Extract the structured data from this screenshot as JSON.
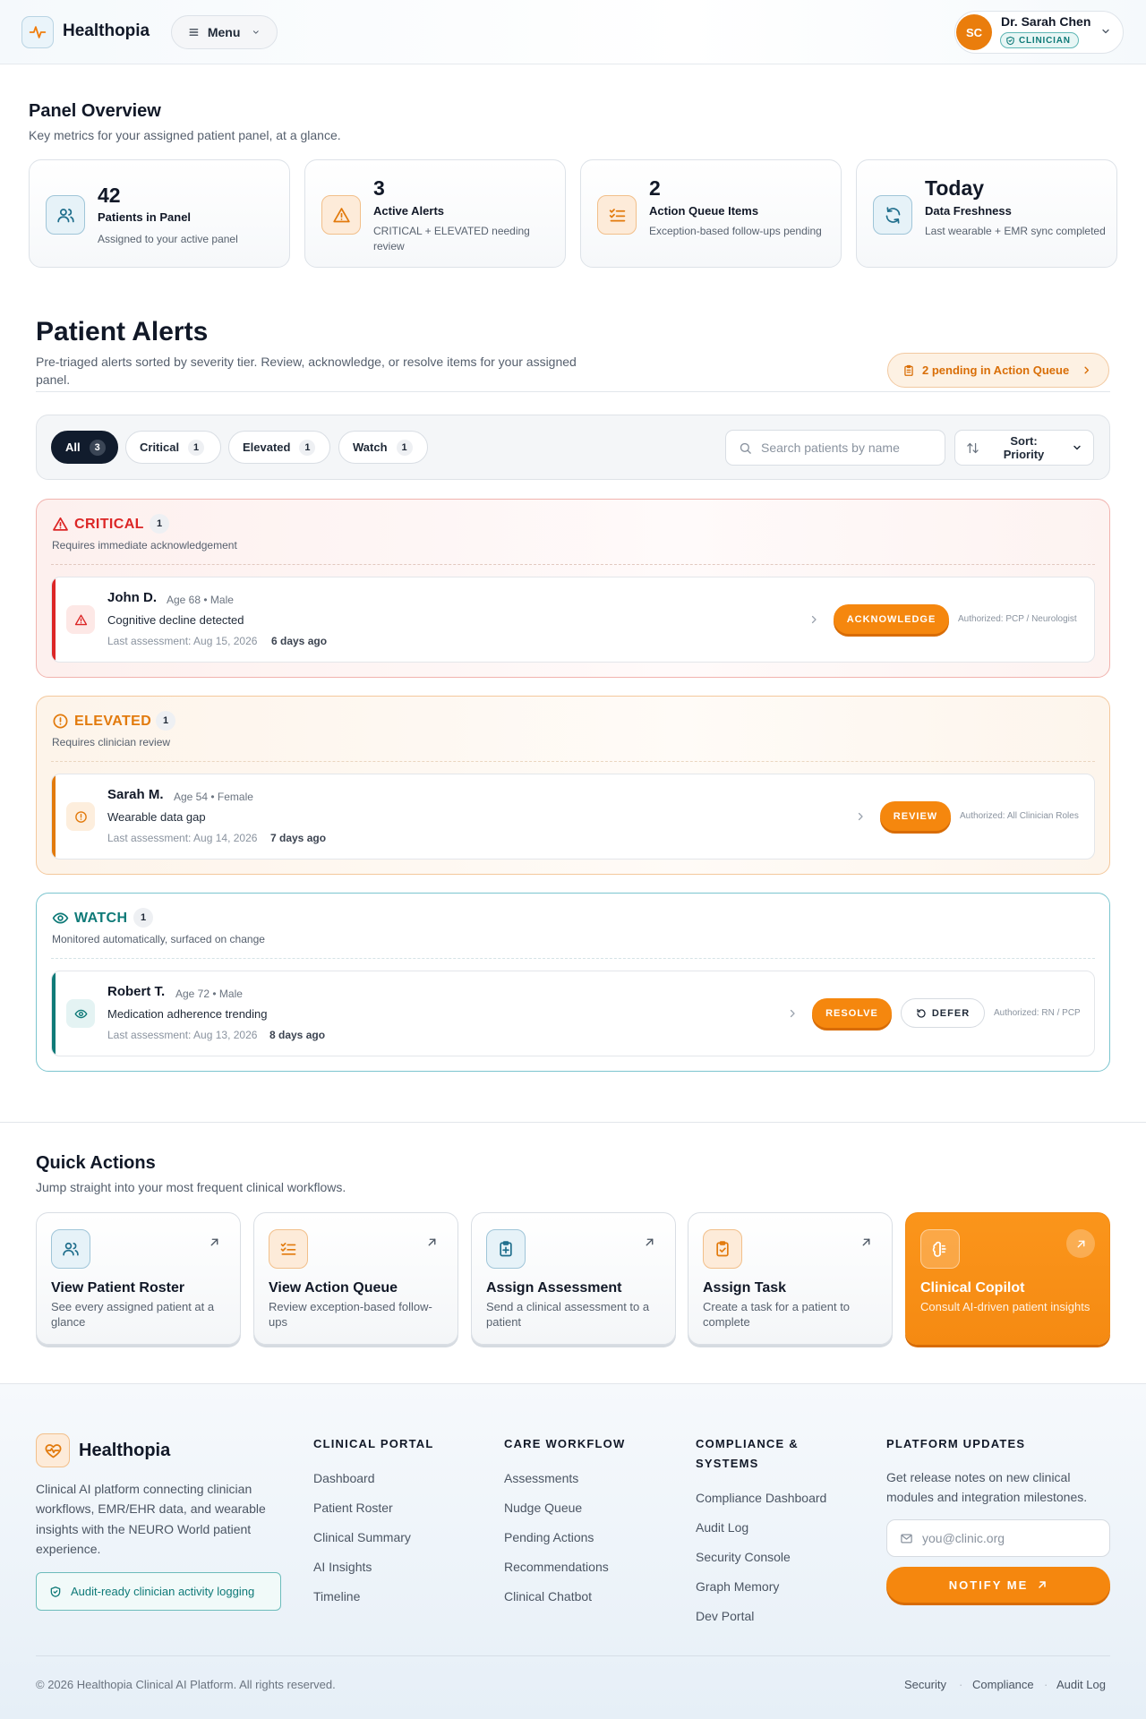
{
  "header": {
    "brand": "Healthopia",
    "menu_label": "Menu",
    "user": {
      "initials": "SC",
      "name": "Dr. Sarah Chen",
      "role": "CLINICIAN"
    }
  },
  "panel_overview": {
    "title": "Panel Overview",
    "subtitle": "Key metrics for your assigned patient panel, at a glance.",
    "stats": [
      {
        "value": "42",
        "label": "Patients in Panel",
        "desc": "Assigned to your active panel",
        "icon": "users-icon"
      },
      {
        "value": "3",
        "label": "Active Alerts",
        "desc": "CRITICAL + ELEVATED needing review",
        "icon": "warning-icon"
      },
      {
        "value": "2",
        "label": "Action Queue Items",
        "desc": "Exception-based follow-ups pending",
        "icon": "list-check-icon"
      },
      {
        "value": "Today",
        "label": "Data Freshness",
        "desc": "Last wearable + EMR sync completed",
        "icon": "refresh-icon"
      }
    ]
  },
  "alerts": {
    "title": "Patient Alerts",
    "subtitle": "Pre-triaged alerts sorted by severity tier. Review, acknowledge, or resolve items for your assigned panel.",
    "pending_pill": "2 pending in Action Queue",
    "filters": [
      {
        "label": "All",
        "count": "3"
      },
      {
        "label": "Critical",
        "count": "1"
      },
      {
        "label": "Elevated",
        "count": "1"
      },
      {
        "label": "Watch",
        "count": "1"
      }
    ],
    "search_placeholder": "Search patients by name",
    "sort_label": "Sort: Priority",
    "tiers": [
      {
        "name": "CRITICAL",
        "count": "1",
        "desc": "Requires immediate acknowledgement",
        "patient": {
          "name": "John D.",
          "meta": "Age 68 • Male",
          "finding": "Cognitive decline detected",
          "last": "Last assessment: Aug 15, 2026",
          "ago": "6 days ago",
          "action": "ACKNOWLEDGE",
          "auth": "Authorized: PCP / Neurologist"
        }
      },
      {
        "name": "ELEVATED",
        "count": "1",
        "desc": "Requires clinician review",
        "patient": {
          "name": "Sarah M.",
          "meta": "Age 54 • Female",
          "finding": "Wearable data gap",
          "last": "Last assessment: Aug 14, 2026",
          "ago": "7 days ago",
          "action": "REVIEW",
          "auth": "Authorized: All Clinician Roles"
        }
      },
      {
        "name": "WATCH",
        "count": "1",
        "desc": "Monitored automatically, surfaced on change",
        "patient": {
          "name": "Robert T.",
          "meta": "Age 72 • Male",
          "finding": "Medication adherence trending",
          "last": "Last assessment: Aug 13, 2026",
          "ago": "8 days ago",
          "action": "RESOLVE",
          "secondary_action": "DEFER",
          "auth": "Authorized: RN / PCP"
        }
      }
    ],
    "colors": {
      "critical": "#dc2626",
      "elevated": "#e27a0c",
      "watch": "#0f7a78",
      "accent": "#f5870e"
    }
  },
  "quick_actions": {
    "title": "Quick Actions",
    "subtitle": "Jump straight into your most frequent clinical workflows.",
    "items": [
      {
        "title": "View Patient Roster",
        "desc": "See every assigned patient at a glance"
      },
      {
        "title": "View Action Queue",
        "desc": "Review exception-based follow-ups"
      },
      {
        "title": "Assign Assessment",
        "desc": "Send a clinical assessment to a patient"
      },
      {
        "title": "Assign Task",
        "desc": "Create a task for a patient to complete"
      },
      {
        "title": "Clinical Copilot",
        "desc": "Consult AI-driven patient insights"
      }
    ]
  },
  "footer": {
    "brand": "Healthopia",
    "desc": "Clinical AI platform connecting clinician workflows, EMR/EHR data, and wearable insights with the NEURO World patient experience.",
    "audit_badge": "Audit-ready clinician activity logging",
    "columns": [
      {
        "title": "CLINICAL PORTAL",
        "links": [
          "Dashboard",
          "Patient Roster",
          "Clinical Summary",
          "AI Insights",
          "Timeline"
        ]
      },
      {
        "title": "CARE WORKFLOW",
        "links": [
          "Assessments",
          "Nudge Queue",
          "Pending Actions",
          "Recommendations",
          "Clinical Chatbot"
        ]
      },
      {
        "title": "COMPLIANCE & SYSTEMS",
        "links": [
          "Compliance Dashboard",
          "Audit Log",
          "Security Console",
          "Graph Memory",
          "Dev Portal"
        ]
      }
    ],
    "updates": {
      "title": "PLATFORM UPDATES",
      "desc": "Get release notes on new clinical modules and integration milestones.",
      "email_placeholder": "you@clinic.org",
      "button": "NOTIFY ME"
    },
    "copyright": "© 2026 Healthopia Clinical AI Platform. All rights reserved.",
    "legal": [
      "Security",
      "Compliance",
      "Audit Log"
    ]
  }
}
